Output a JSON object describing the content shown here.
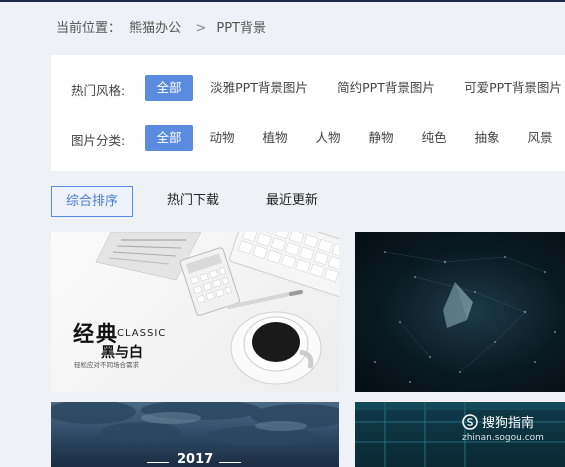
{
  "breadcrumb": {
    "prefix": "当前位置：",
    "home": "熊猫办公",
    "separator": ">",
    "current": "PPT背景"
  },
  "filters": {
    "style": {
      "label": "热门风格:",
      "options": [
        "全部",
        "淡雅PPT背景图片",
        "简约PPT背景图片",
        "可爱PPT背景图片"
      ],
      "selected": "全部"
    },
    "category": {
      "label": "图片分类:",
      "options": [
        "全部",
        "动物",
        "植物",
        "人物",
        "静物",
        "纯色",
        "抽象",
        "风景"
      ],
      "selected": "全部"
    }
  },
  "sort": {
    "tabs": [
      "综合排序",
      "热门下载",
      "最近更新"
    ],
    "selected": "综合排序"
  },
  "thumbnails": [
    {
      "title_cn": "经典",
      "title_en": "CLASSIC",
      "subtitle": "黑与白",
      "tagline": "轻松应对不同场合需求",
      "newspaper_text": "BUSINESS"
    },
    {
      "theme": "dark-network-polygon"
    },
    {
      "year": "2017"
    },
    {
      "theme": "dark-teal-lines"
    }
  ],
  "watermark": {
    "brand": "搜狗指南",
    "url": "zhinan.sogou.com"
  },
  "colors": {
    "accent": "#5b8bde",
    "topbar": "#1e2a4a",
    "background": "#eef1f5"
  }
}
